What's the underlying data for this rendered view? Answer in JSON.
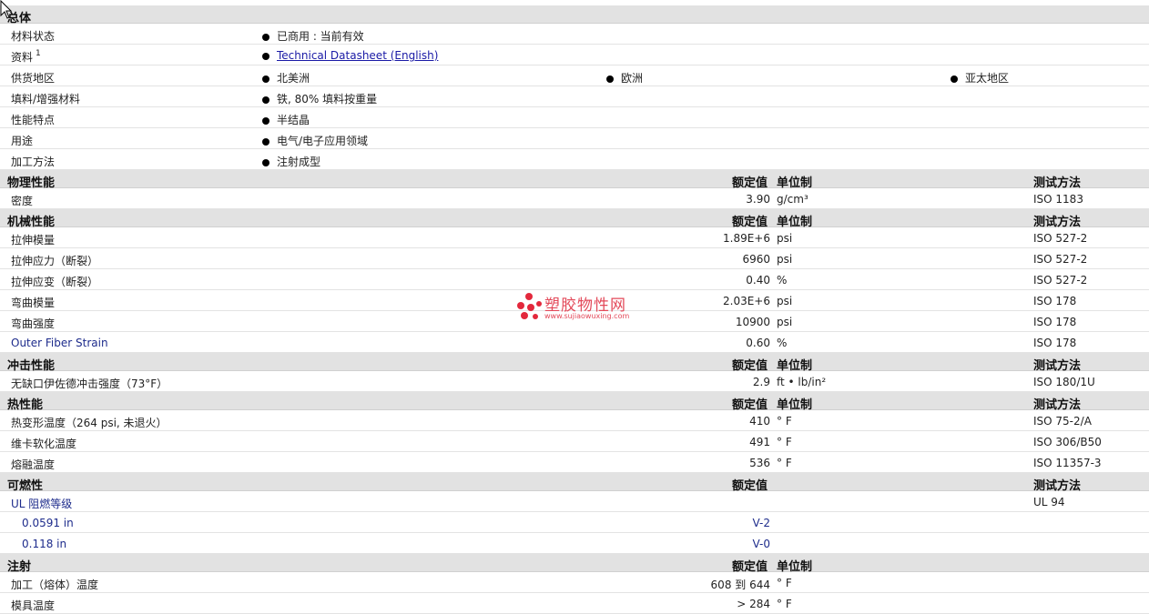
{
  "general": {
    "title": "总体",
    "rows": [
      {
        "label": "材料状态",
        "items": [
          "已商用 : 当前有效"
        ]
      },
      {
        "label": "资料",
        "sup": "1",
        "items": [
          "Technical Datasheet (English)"
        ]
      },
      {
        "label": "供货地区",
        "items": [
          "北美洲",
          "欧洲",
          "亚太地区"
        ]
      },
      {
        "label": "填料/增强材料",
        "items": [
          "铁, 80% 填料按重量"
        ]
      },
      {
        "label": "性能特点",
        "items": [
          "半结晶"
        ]
      },
      {
        "label": "用途",
        "items": [
          "电气/电子应用领域"
        ]
      },
      {
        "label": "加工方法",
        "items": [
          "注射成型"
        ]
      }
    ]
  },
  "columns": {
    "rated": "额定值",
    "unit": "单位制",
    "test": "测试方法"
  },
  "physical": {
    "title": "物理性能",
    "rows": [
      {
        "label": "密度",
        "value": "3.90",
        "unit": "g/cm³",
        "test": "ISO 1183"
      }
    ]
  },
  "mechanical": {
    "title": "机械性能",
    "rows": [
      {
        "label": "拉伸模量",
        "value": "1.89E+6",
        "unit": "psi",
        "test": "ISO 527-2"
      },
      {
        "label": "拉伸应力（断裂）",
        "value": "6960",
        "unit": "psi",
        "test": "ISO 527-2"
      },
      {
        "label": "拉伸应变（断裂）",
        "value": "0.40",
        "unit": "%",
        "test": "ISO 527-2"
      },
      {
        "label": "弯曲模量",
        "value": "2.03E+6",
        "unit": "psi",
        "test": "ISO 178"
      },
      {
        "label": "弯曲强度",
        "value": "10900",
        "unit": "psi",
        "test": "ISO 178"
      },
      {
        "label": "Outer Fiber Strain",
        "value": "0.60",
        "unit": "%",
        "test": "ISO 178"
      }
    ]
  },
  "impact": {
    "title": "冲击性能",
    "rows": [
      {
        "label": "无缺口伊佐德冲击强度（73°F）",
        "value": "2.9",
        "unit": "ft • lb/in²",
        "test": "ISO 180/1U"
      }
    ]
  },
  "thermal": {
    "title": "热性能",
    "rows": [
      {
        "label": "热变形温度（264 psi, 未退火）",
        "value": "410",
        "unit": "° F",
        "test": "ISO 75-2/A"
      },
      {
        "label": "维卡软化温度",
        "value": "491",
        "unit": "° F",
        "test": "ISO 306/B50"
      },
      {
        "label": "熔融温度",
        "value": "536",
        "unit": "° F",
        "test": "ISO 11357-3"
      }
    ]
  },
  "flammability": {
    "title": "可燃性",
    "rows": [
      {
        "label": "UL 阻燃等级",
        "value": "",
        "unit": "",
        "test": "UL 94"
      },
      {
        "label": "0.0591 in",
        "value": "V-2",
        "unit": "",
        "test": ""
      },
      {
        "label": "0.118 in",
        "value": "V-0",
        "unit": "",
        "test": ""
      }
    ]
  },
  "injection": {
    "title": "注射",
    "rows": [
      {
        "label": "加工（熔体）温度",
        "value": "608 到  644",
        "unit": "° F"
      },
      {
        "label": "模具温度",
        "value": "> 284",
        "unit": "° F"
      }
    ]
  },
  "watermark": {
    "title": "塑胶物性网",
    "url": "www.sujiaowuxing.com"
  }
}
